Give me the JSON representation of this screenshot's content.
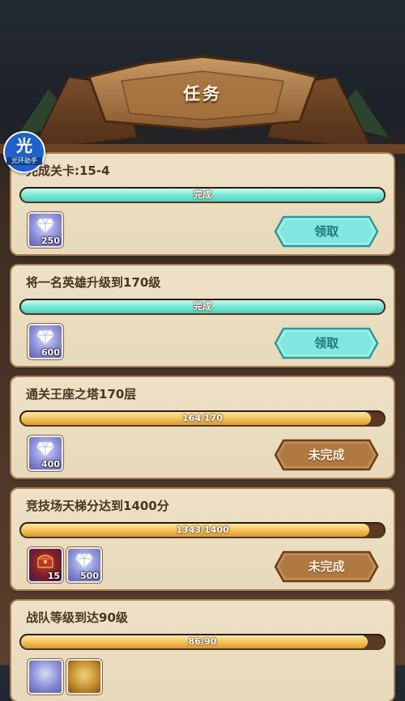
{
  "header": {
    "title": "任务"
  },
  "badge": {
    "glyph": "光",
    "label": "光环助手"
  },
  "colors": {
    "complete_bar": "#7ee9d9",
    "progress_bar": "#f5c35c",
    "claim_button": "#7ee6e2",
    "pending_button": "#b5824a"
  },
  "tasks": [
    {
      "title": "完成关卡:15-4",
      "progress_text": "完成",
      "progress": 1.0,
      "status": "complete",
      "rewards": [
        {
          "icon": "diamond-icon",
          "qty": "250"
        }
      ],
      "button_label": "领取"
    },
    {
      "title": "将一名英雄升级到170级",
      "progress_text": "完成",
      "progress": 1.0,
      "status": "complete",
      "rewards": [
        {
          "icon": "diamond-icon",
          "qty": "600"
        }
      ],
      "button_label": "领取"
    },
    {
      "title": "通关王座之塔170层",
      "progress_text": "164/170",
      "progress": 0.965,
      "status": "incomplete",
      "rewards": [
        {
          "icon": "diamond-icon",
          "qty": "400"
        }
      ],
      "button_label": "未完成"
    },
    {
      "title": "竞技场天梯分达到1400分",
      "progress_text": "1343/1400",
      "progress": 0.959,
      "status": "incomplete",
      "rewards": [
        {
          "icon": "treasure-chest-icon",
          "qty": "15"
        },
        {
          "icon": "diamond-icon",
          "qty": "500"
        }
      ],
      "button_label": "未完成"
    },
    {
      "title": "战队等级到达90级",
      "progress_text": "86/90",
      "progress": 0.956,
      "status": "incomplete",
      "rewards": [],
      "button_label": ""
    }
  ]
}
